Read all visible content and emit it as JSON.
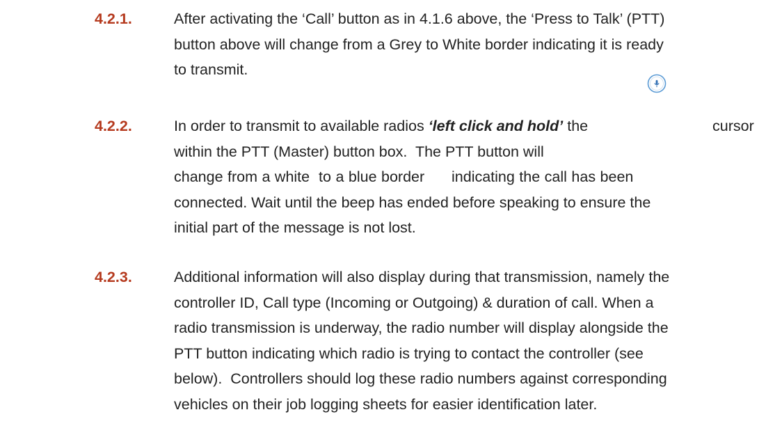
{
  "section_4_2_1": {
    "number": "4.2.1.",
    "lines": [
      "After activating the ‘Call’ button as in 4.1.6 above, the ‘Press to Talk’ (PTT)",
      "button above will change from a Grey to White border indicating it is ready",
      "to transmit."
    ]
  },
  "section_4_2_2": {
    "number": "4.2.2.",
    "line1_pre": "In order to transmit to available radios",
    "line1_em": "‘left click and hold’",
    "line1_post": "the",
    "line1_end": "cursor",
    "line2": "within the PTT (Master) button box.  The PTT button will",
    "line3": "change from a white  to a blue border      indicating the call has been",
    "line4": "connected. Wait until the beep has ended before speaking to ensure the",
    "line5": "initial part of the message is not lost.",
    "icon": "ptt-mic-icon"
  },
  "section_4_2_3": {
    "number": "4.2.3.",
    "lines": [
      "Additional information will also display during that transmission, namely the",
      "controller ID, Call type (Incoming or Outgoing) & duration of call. When a",
      "radio transmission is underway, the radio number will display alongside the",
      "PTT button indicating which radio is trying to contact the controller (see",
      "below).  Controllers should log these radio numbers against corresponding",
      "vehicles on their job logging sheets for easier identification later."
    ]
  },
  "colors": {
    "number": "#b53a1e",
    "text": "#222222",
    "icon_ring": "#5b9bd5"
  }
}
